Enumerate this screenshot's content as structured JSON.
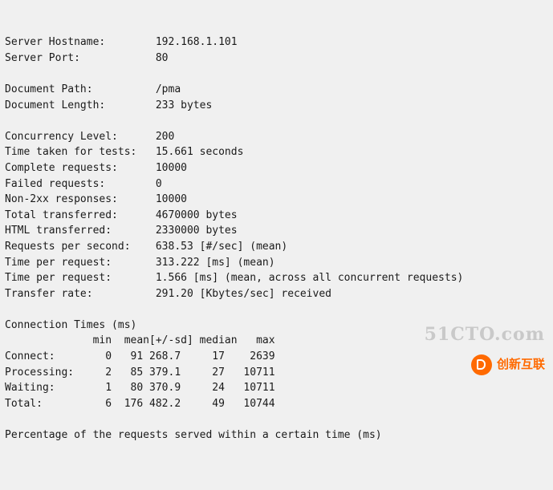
{
  "terminal": {
    "lines": [
      "Server Hostname:        192.168.1.101",
      "Server Port:            80",
      "",
      "Document Path:          /pma",
      "Document Length:        233 bytes",
      "",
      "Concurrency Level:      200",
      "Time taken for tests:   15.661 seconds",
      "Complete requests:      10000",
      "Failed requests:        0",
      "Non-2xx responses:      10000",
      "Total transferred:      4670000 bytes",
      "HTML transferred:       2330000 bytes",
      "Requests per second:    638.53 [#/sec] (mean)",
      "Time per request:       313.222 [ms] (mean)",
      "Time per request:       1.566 [ms] (mean, across all concurrent requests)",
      "Transfer rate:          291.20 [Kbytes/sec] received",
      "",
      "Connection Times (ms)",
      "              min  mean[+/-sd] median   max",
      "Connect:        0   91 268.7     17    2639",
      "Processing:     2   85 379.1     27   10711",
      "Waiting:        1   80 370.9     24   10711",
      "Total:          6  176 482.2     49   10744",
      "",
      "Percentage of the requests served within a certain time (ms)"
    ]
  },
  "watermark": {
    "site": "51CTO.com",
    "brand": "创新互联"
  }
}
